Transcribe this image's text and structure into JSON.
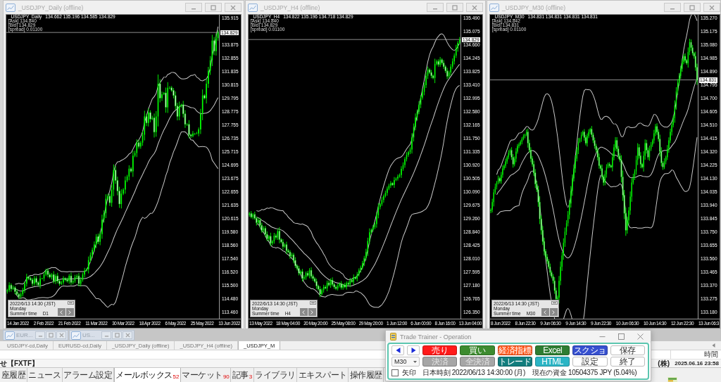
{
  "charts": [
    {
      "title": "_USDJPY_Daily (offline)",
      "symbol": "_USDJPY_Daily",
      "ohlc": "134.662 135.196 134.585 134.829",
      "ask": "[Ask] 134.840",
      "bid": "[Bid] 134.829",
      "spread": "[spread] 0.01100",
      "current_price": "134.829",
      "price_labels": [
        "135.915",
        "133.875",
        "132.855",
        "131.835",
        "130.815",
        "129.795",
        "128.775",
        "127.755",
        "126.735",
        "125.715",
        "124.695",
        "123.675",
        "122.655",
        "121.635",
        "120.615",
        "119.580",
        "118.560",
        "117.540",
        "116.520",
        "115.500",
        "114.480",
        "113.460"
      ],
      "time_labels": [
        "14 Jan 2022",
        "2 Feb 2022",
        "21 Feb 2022",
        "11 Mar 2022",
        "30 Mar 2022",
        "18 Apr 2022",
        "6 May 2022",
        "25 May 2022",
        "13 Jun 2022"
      ],
      "info": {
        "datetime": "2022/6/13 14:30 (JST)",
        "weekday": "Monday",
        "season": "Summer time",
        "timeframe": "D1"
      }
    },
    {
      "title": "_USDJPY_H4 (offline)",
      "symbol": "_USDJPY_H4",
      "ohlc": "134.822 135.196 134.718 134.829",
      "ask": "[Ask] 134.840",
      "bid": "[Bid] 134.829",
      "spread": "[spread] 0.01100",
      "current_price": "134.829",
      "price_labels": [
        "135.490",
        "135.075",
        "134.660",
        "134.245",
        "133.825",
        "133.410",
        "132.995",
        "132.580",
        "132.165",
        "131.750",
        "131.335",
        "130.920",
        "130.505",
        "130.090",
        "129.675",
        "129.260",
        "128.840",
        "128.425",
        "128.010",
        "127.595",
        "127.180",
        "126.765",
        "126.350"
      ],
      "time_labels": [
        "13 May 2022",
        "18 May 04:00",
        "20 May 20:00",
        "25 May 08:00",
        "29 May 20:00",
        "1 Jun 12:00",
        "6 Jun 00:00",
        "8 Jun 16:00",
        "13 Jun 04:00"
      ],
      "info": {
        "datetime": "2022/6/13 14:30 (JST)",
        "weekday": "Monday",
        "season": "Summer time",
        "timeframe": "H4"
      }
    },
    {
      "title": "_USDJPY_M30 (offline)",
      "symbol": "_USDJPY_M30",
      "ohlc": "134.831 134.831 134.831 134.831",
      "ask": "[Ask] 134.842",
      "bid": "[Bid] 134.831",
      "spread": "[spread] 0.01100",
      "current_price": "134.831",
      "price_labels": [
        "135.270",
        "135.175",
        "135.080",
        "134.985",
        "134.890",
        "134.795",
        "134.700",
        "134.605",
        "134.510",
        "134.415",
        "134.320",
        "134.225",
        "134.130",
        "134.035",
        "133.940",
        "133.845",
        "133.750",
        "133.655",
        "133.560",
        "133.465",
        "133.370",
        "133.275",
        "133.180"
      ],
      "time_labels": [
        "8 Jun 2022",
        "8 Jun 22:30",
        "9 Jun 06:30",
        "9 Jun 14:30",
        "9 Jun 22:30",
        "10 Jun 06:30",
        "10 Jun 14:30",
        "12 Jun 22:30",
        "13 Jun 06:3"
      ],
      "info": {
        "datetime": "2022/6/13 14:30 (JST)",
        "weekday": "Monday",
        "season": "Summer time",
        "timeframe": "M30"
      }
    }
  ],
  "minimized_windows": [
    {
      "title": "EUR..."
    },
    {
      "title": "US..."
    }
  ],
  "chart_tabs": [
    {
      "label": "USDJPY-cd,Daily",
      "selected": false
    },
    {
      "label": "EURUSD-cd,Daily",
      "selected": false
    },
    {
      "label": "_USDJPY_Daily (offline)",
      "selected": false
    },
    {
      "label": "_USDJPY_H4 (offline)",
      "selected": false
    },
    {
      "label": "_USDJPY_M",
      "selected": true
    }
  ],
  "terminal": {
    "time_header": "時間",
    "rows": [
      {
        "column_1": "せ【FXTF】",
        "column_2": "(株)",
        "time": "2025.06.16 23:58"
      }
    ],
    "tabs": [
      {
        "label": "座履歴",
        "selected": false
      },
      {
        "label": "ニュース",
        "selected": false
      },
      {
        "label": "アラーム設定",
        "selected": false
      },
      {
        "label": "メールボックス",
        "count": "52",
        "selected": true
      },
      {
        "label": "マーケット",
        "count": "90",
        "selected": false
      },
      {
        "label": "記事",
        "count": "3",
        "selected": false
      },
      {
        "label": "ライブラリ",
        "selected": false
      },
      {
        "label": "エキスパート",
        "selected": false
      },
      {
        "label": "操作履歴",
        "selected": false
      }
    ]
  },
  "trade_trainer": {
    "title": "Trade Trainer - Operation",
    "timeframe": "M30",
    "buttons": [
      {
        "label": "売り",
        "color": "#ff1a1a",
        "disabled": false
      },
      {
        "label": "買い",
        "color": "#3d8b2f",
        "disabled": false
      },
      {
        "label": "経済指標",
        "color": "#ff5a1f",
        "disabled": false
      },
      {
        "label": "Excel",
        "color": "#2e7d32",
        "disabled": false
      },
      {
        "label": "スクショ",
        "color": "#3650d0",
        "disabled": false
      },
      {
        "label": "保存",
        "color": "#ffffff",
        "disabled": false
      },
      {
        "label": "決済",
        "color": "#a6a6a6",
        "disabled": true
      },
      {
        "label": "全決済",
        "color": "#a6a6a6",
        "disabled": true
      },
      {
        "label": "トレード",
        "color": "#127d7d",
        "disabled": false
      },
      {
        "label": "HTML",
        "color": "#2bb5c5",
        "disabled": false
      },
      {
        "label": "設定",
        "color": "#ffffff",
        "disabled": false
      },
      {
        "label": "終了",
        "color": "#ffffff",
        "disabled": false
      }
    ],
    "arrow_checkbox": {
      "label": "矢印",
      "checked": false
    },
    "japan_time": "日本時刻 2022/06/13 14:30:00 (月)",
    "funds": "現在の資金 10504375 JPY (5.04%)"
  }
}
